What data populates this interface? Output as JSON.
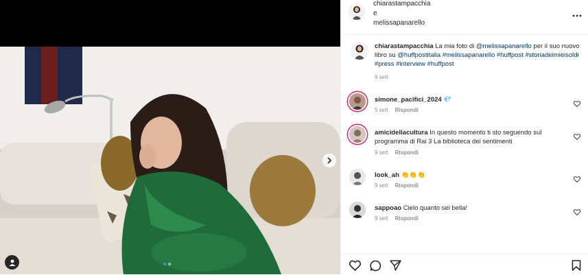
{
  "post": {
    "author": "chiarastampacchia",
    "and_word": "e",
    "coauthor": "melissapanarello",
    "more_icon": "more-options-icon",
    "image_dots_count": 2
  },
  "caption": {
    "username": "chiarastampacchia",
    "text_before": "La mia foto di ",
    "mention1": "@melissapanarello",
    "text_mid": " per il suo nuovo libro su ",
    "mention2": "@huffpostitalia",
    "hashtags": "#melissapanarello #huffpost #storiadeimieisoldi #press #interview #huffpost",
    "time": "9 sett"
  },
  "comments": [
    {
      "username": "simone_pacifici_2024",
      "text": "💎",
      "time": "5 sett",
      "reply": "Rispondi"
    },
    {
      "username": "amicidellacultura",
      "text": "In questo momento ti sto seguendo sul programma di Rai 3 La biblioteca dei sentimenti",
      "time": "9 sett",
      "reply": "Rispondi"
    },
    {
      "username": "look_ah",
      "text": "👏👏👏",
      "time": "9 sett",
      "reply": "Rispondi"
    },
    {
      "username": "sappoao",
      "text": "Cielo quanto sei bella!",
      "time": "9 sett",
      "reply": "Rispondi"
    }
  ],
  "actions": [
    "heart-icon",
    "comment-icon",
    "share-icon",
    "save-icon"
  ],
  "colors": {
    "link": "#00376b",
    "story_ring": "#d8297a",
    "muted": "#8e8e8e",
    "active_dot": "#3b8ee8"
  }
}
